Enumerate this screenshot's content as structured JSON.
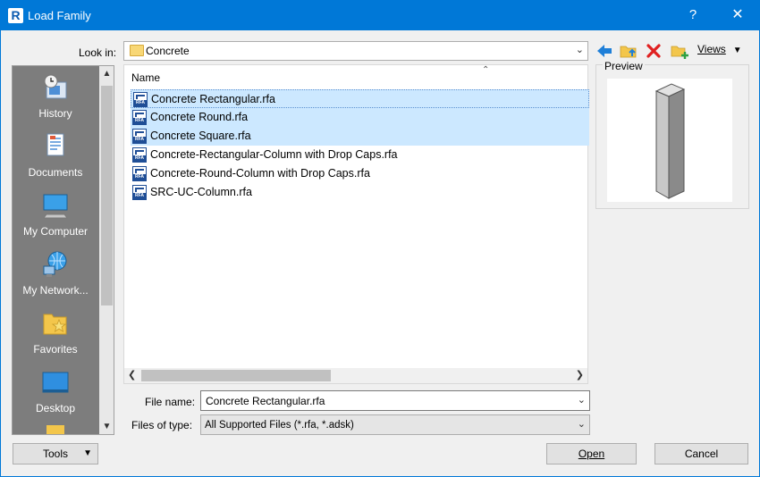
{
  "window": {
    "title": "Load Family",
    "help_glyph": "?",
    "close_glyph": "✕",
    "app_icon_letter": "R"
  },
  "look_in": {
    "label": "Look in:",
    "value": "Concrete"
  },
  "toolbar": {
    "views_label": "Views"
  },
  "places": [
    {
      "label": "History",
      "icon": "history-icon"
    },
    {
      "label": "Documents",
      "icon": "documents-icon"
    },
    {
      "label": "My Computer",
      "icon": "computer-icon"
    },
    {
      "label": "My Network...",
      "icon": "network-icon"
    },
    {
      "label": "Favorites",
      "icon": "favorites-icon"
    },
    {
      "label": "Desktop",
      "icon": "desktop-icon"
    }
  ],
  "file_list": {
    "column_header": "Name",
    "files": [
      {
        "name": "Concrete Rectangular.rfa",
        "selected": true,
        "focused": true
      },
      {
        "name": "Concrete Round.rfa",
        "selected": true
      },
      {
        "name": "Concrete Square.rfa",
        "selected": true
      },
      {
        "name": "Concrete-Rectangular-Column with Drop Caps.rfa",
        "selected": false
      },
      {
        "name": "Concrete-Round-Column with Drop Caps.rfa",
        "selected": false
      },
      {
        "name": "SRC-UC-Column.rfa",
        "selected": false
      }
    ],
    "file_icon_tag": "RFA"
  },
  "preview": {
    "label": "Preview"
  },
  "file_name": {
    "label": "File name:",
    "value": "Concrete Rectangular.rfa"
  },
  "file_type": {
    "label": "Files of type:",
    "value": "All Supported Files  (*.rfa, *.adsk)"
  },
  "buttons": {
    "tools": "Tools",
    "open": "Open",
    "cancel": "Cancel"
  },
  "colors": {
    "titlebar": "#0078d7",
    "selection": "#cce8ff",
    "places_bg": "#7d7d7d"
  }
}
